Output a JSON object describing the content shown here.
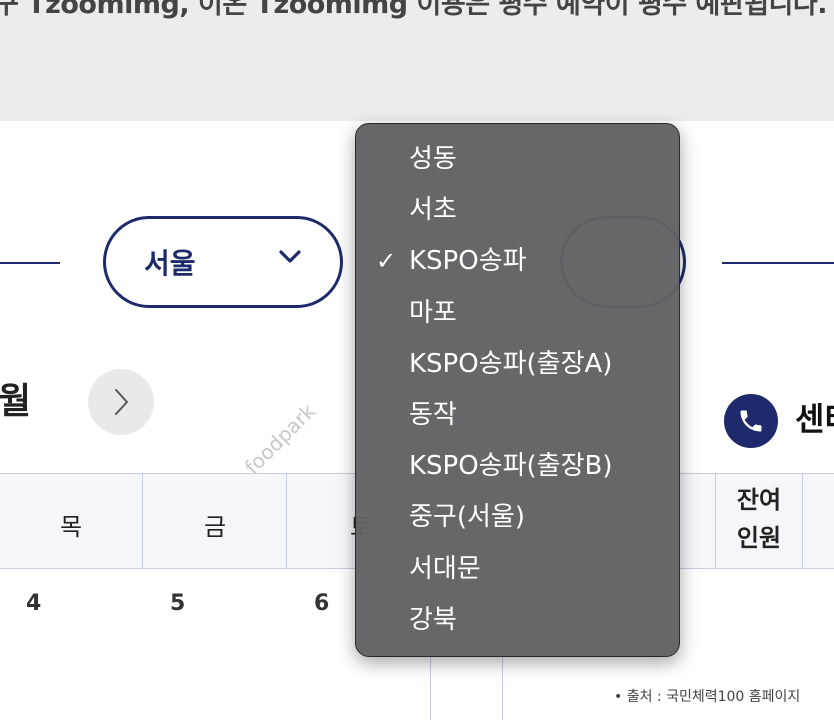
{
  "banner": {
    "text": "구 Tzoomimg, 이온 Tzoomimg 이용은 평수 예약이 평수 예판됩니다."
  },
  "region_select": {
    "selected": "서울"
  },
  "calendar_nav": {
    "month_label": "월",
    "next_month_symbol": "›"
  },
  "center_label": "센터",
  "calendar": {
    "day_headers": [
      "목",
      "금",
      "토"
    ],
    "dates": [
      "4",
      "5",
      "6"
    ],
    "remaining_header_line1": "잔여",
    "remaining_header_line2": "인원"
  },
  "watermark": "foodpark",
  "source_note": "• 출처 : 국민체력100 홈페이지",
  "dropdown": {
    "items": [
      {
        "label": "성동",
        "selected": false
      },
      {
        "label": "서초",
        "selected": false
      },
      {
        "label": "KSPO송파",
        "selected": true
      },
      {
        "label": "마포",
        "selected": false
      },
      {
        "label": "KSPO송파(출장A)",
        "selected": false
      },
      {
        "label": "동작",
        "selected": false
      },
      {
        "label": "KSPO송파(출장B)",
        "selected": false
      },
      {
        "label": "중구(서울)",
        "selected": false
      },
      {
        "label": "서대문",
        "selected": false
      },
      {
        "label": "강북",
        "selected": false
      }
    ],
    "check_mark": "✓"
  },
  "colors": {
    "navy": "#1e2a6b",
    "menu_bg": "#626264",
    "banner_bg": "#ececec",
    "header_bg": "#f4f6fa"
  }
}
